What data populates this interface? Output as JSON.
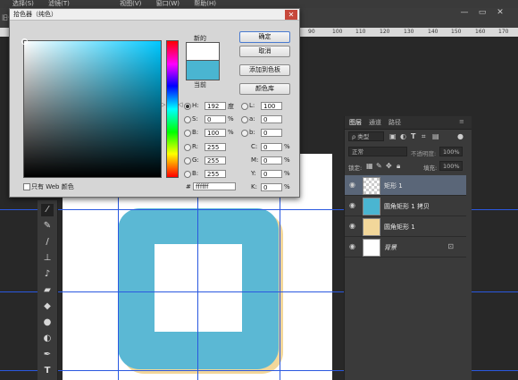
{
  "menubar": {
    "items": [
      "选择(S)",
      "滤镜(T)",
      "视图(V)",
      "窗口(W)",
      "帮助(H)"
    ]
  },
  "options_bar": {
    "left_text": "旧作"
  },
  "window_controls": {
    "minimize": "—",
    "maximize": "▭",
    "close": "✕"
  },
  "ruler": {
    "ticks": [
      "90",
      "100",
      "110",
      "120",
      "130",
      "140",
      "150",
      "160",
      "170"
    ]
  },
  "dialog": {
    "title": "拾色器（纯色）",
    "close": "✕",
    "new_label": "新的",
    "current_label": "当前",
    "colors": {
      "new": "#ffffff",
      "current": "#4ab5d1"
    },
    "buttons": {
      "ok": "确定",
      "cancel": "取消",
      "add_swatch": "添加到色板",
      "libraries": "颜色库"
    },
    "fields": {
      "H": {
        "label": "H:",
        "value": "192",
        "unit": "度"
      },
      "S": {
        "label": "S:",
        "value": "0",
        "unit": "%"
      },
      "Bv": {
        "label": "B:",
        "value": "100",
        "unit": "%"
      },
      "R": {
        "label": "R:",
        "value": "255"
      },
      "G": {
        "label": "G:",
        "value": "255"
      },
      "Bc": {
        "label": "B:",
        "value": "255"
      },
      "L": {
        "label": "L:",
        "value": "100"
      },
      "a": {
        "label": "a:",
        "value": "0"
      },
      "b": {
        "label": "b:",
        "value": "0"
      },
      "C": {
        "label": "C:",
        "value": "0",
        "unit": "%"
      },
      "M": {
        "label": "M:",
        "value": "0",
        "unit": "%"
      },
      "Y": {
        "label": "Y:",
        "value": "0",
        "unit": "%"
      },
      "K": {
        "label": "K:",
        "value": "0",
        "unit": "%"
      }
    },
    "hex_label": "#",
    "hex_value": "ffffff",
    "web_only_label": "只有 Web 颜色"
  },
  "canvas": {
    "shape_colors": {
      "main": "#5bb8d4",
      "shadow": "#f2d79a",
      "inner": "#ffffff"
    }
  },
  "layers": {
    "tabs": [
      "图层",
      "通道",
      "路径"
    ],
    "filter_label": "ρ 类型",
    "blend_mode": "正常",
    "opacity_label": "不透明度:",
    "opacity_value": "100%",
    "lock_label": "锁定:",
    "fill_label": "填充:",
    "fill_value": "100%",
    "items": [
      {
        "name": "矩形 1"
      },
      {
        "name": "圆角矩形 1 拷贝"
      },
      {
        "name": "圆角矩形 1"
      },
      {
        "name": "背景"
      }
    ]
  }
}
